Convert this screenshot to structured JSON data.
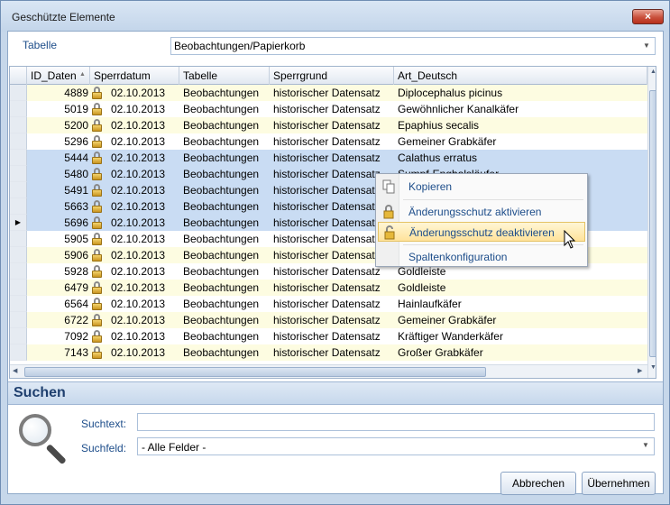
{
  "window": {
    "title": "Geschützte Elemente",
    "close_icon": "×"
  },
  "filter": {
    "label": "Tabelle",
    "value": "Beobachtungen/Papierkorb"
  },
  "grid": {
    "columns": [
      "ID_Daten",
      "Sperrdatum",
      "Tabelle",
      "Sperrgrund",
      "Art_Deutsch"
    ],
    "rows": [
      {
        "id": "4889",
        "date": "02.10.2013",
        "table": "Beobachtungen",
        "reason": "historischer Datensatz",
        "art": "Diplocephalus picinus",
        "state": "odd"
      },
      {
        "id": "5019",
        "date": "02.10.2013",
        "table": "Beobachtungen",
        "reason": "historischer Datensatz",
        "art": "Gewöhnlicher Kanalkäfer",
        "state": "even"
      },
      {
        "id": "5200",
        "date": "02.10.2013",
        "table": "Beobachtungen",
        "reason": "historischer Datensatz",
        "art": "Epaphius secalis",
        "state": "odd"
      },
      {
        "id": "5296",
        "date": "02.10.2013",
        "table": "Beobachtungen",
        "reason": "historischer Datensatz",
        "art": "Gemeiner Grabkäfer",
        "state": "even"
      },
      {
        "id": "5444",
        "date": "02.10.2013",
        "table": "Beobachtungen",
        "reason": "historischer Datensatz",
        "art": "Calathus erratus",
        "state": "sel"
      },
      {
        "id": "5480",
        "date": "02.10.2013",
        "table": "Beobachtungen",
        "reason": "historischer Datensatz",
        "art": "Sumpf-Enghalsläufer",
        "state": "sel"
      },
      {
        "id": "5491",
        "date": "02.10.2013",
        "table": "Beobachtungen",
        "reason": "historischer Datensatz",
        "art": "",
        "state": "sel"
      },
      {
        "id": "5663",
        "date": "02.10.2013",
        "table": "Beobachtungen",
        "reason": "historischer Datensatz",
        "art": "",
        "state": "sel"
      },
      {
        "id": "5696",
        "date": "02.10.2013",
        "table": "Beobachtungen",
        "reason": "historischer Datensatz",
        "art": "",
        "state": "sel",
        "current": true
      },
      {
        "id": "5905",
        "date": "02.10.2013",
        "table": "Beobachtungen",
        "reason": "historischer Datensatz",
        "art": "",
        "state": "even"
      },
      {
        "id": "5906",
        "date": "02.10.2013",
        "table": "Beobachtungen",
        "reason": "historischer Datensatz",
        "art": "",
        "state": "odd"
      },
      {
        "id": "5928",
        "date": "02.10.2013",
        "table": "Beobachtungen",
        "reason": "historischer Datensatz",
        "art": "Goldleiste",
        "state": "even"
      },
      {
        "id": "6479",
        "date": "02.10.2013",
        "table": "Beobachtungen",
        "reason": "historischer Datensatz",
        "art": "Goldleiste",
        "state": "odd"
      },
      {
        "id": "6564",
        "date": "02.10.2013",
        "table": "Beobachtungen",
        "reason": "historischer Datensatz",
        "art": "Hainlaufkäfer",
        "state": "even"
      },
      {
        "id": "6722",
        "date": "02.10.2013",
        "table": "Beobachtungen",
        "reason": "historischer Datensatz",
        "art": "Gemeiner Grabkäfer",
        "state": "odd"
      },
      {
        "id": "7092",
        "date": "02.10.2013",
        "table": "Beobachtungen",
        "reason": "historischer Datensatz",
        "art": "Kräftiger Wanderkäfer",
        "state": "even"
      },
      {
        "id": "7143",
        "date": "02.10.2013",
        "table": "Beobachtungen",
        "reason": "historischer Datensatz",
        "art": "Großer Grabkäfer",
        "state": "odd"
      }
    ]
  },
  "context_menu": {
    "items": [
      {
        "label": "Kopieren",
        "icon": "copy-icon"
      },
      {
        "label": "Änderungsschutz aktivieren",
        "icon": "lock-icon"
      },
      {
        "label": "Änderungsschutz deaktivieren",
        "icon": "unlock-icon",
        "highlighted": true
      },
      {
        "label": "Spaltenkonfiguration",
        "icon": ""
      }
    ]
  },
  "search": {
    "title": "Suchen",
    "text_label": "Suchtext:",
    "text_value": "",
    "field_label": "Suchfeld:",
    "field_value": "- Alle Felder -"
  },
  "buttons": {
    "cancel": "Abbrechen",
    "accept": "Übernehmen"
  },
  "colors": {
    "title_blue": "#1e3f6e",
    "selection": "#c9dcf3",
    "alt_row": "#fdfce1",
    "highlight": "#ffe39b"
  }
}
